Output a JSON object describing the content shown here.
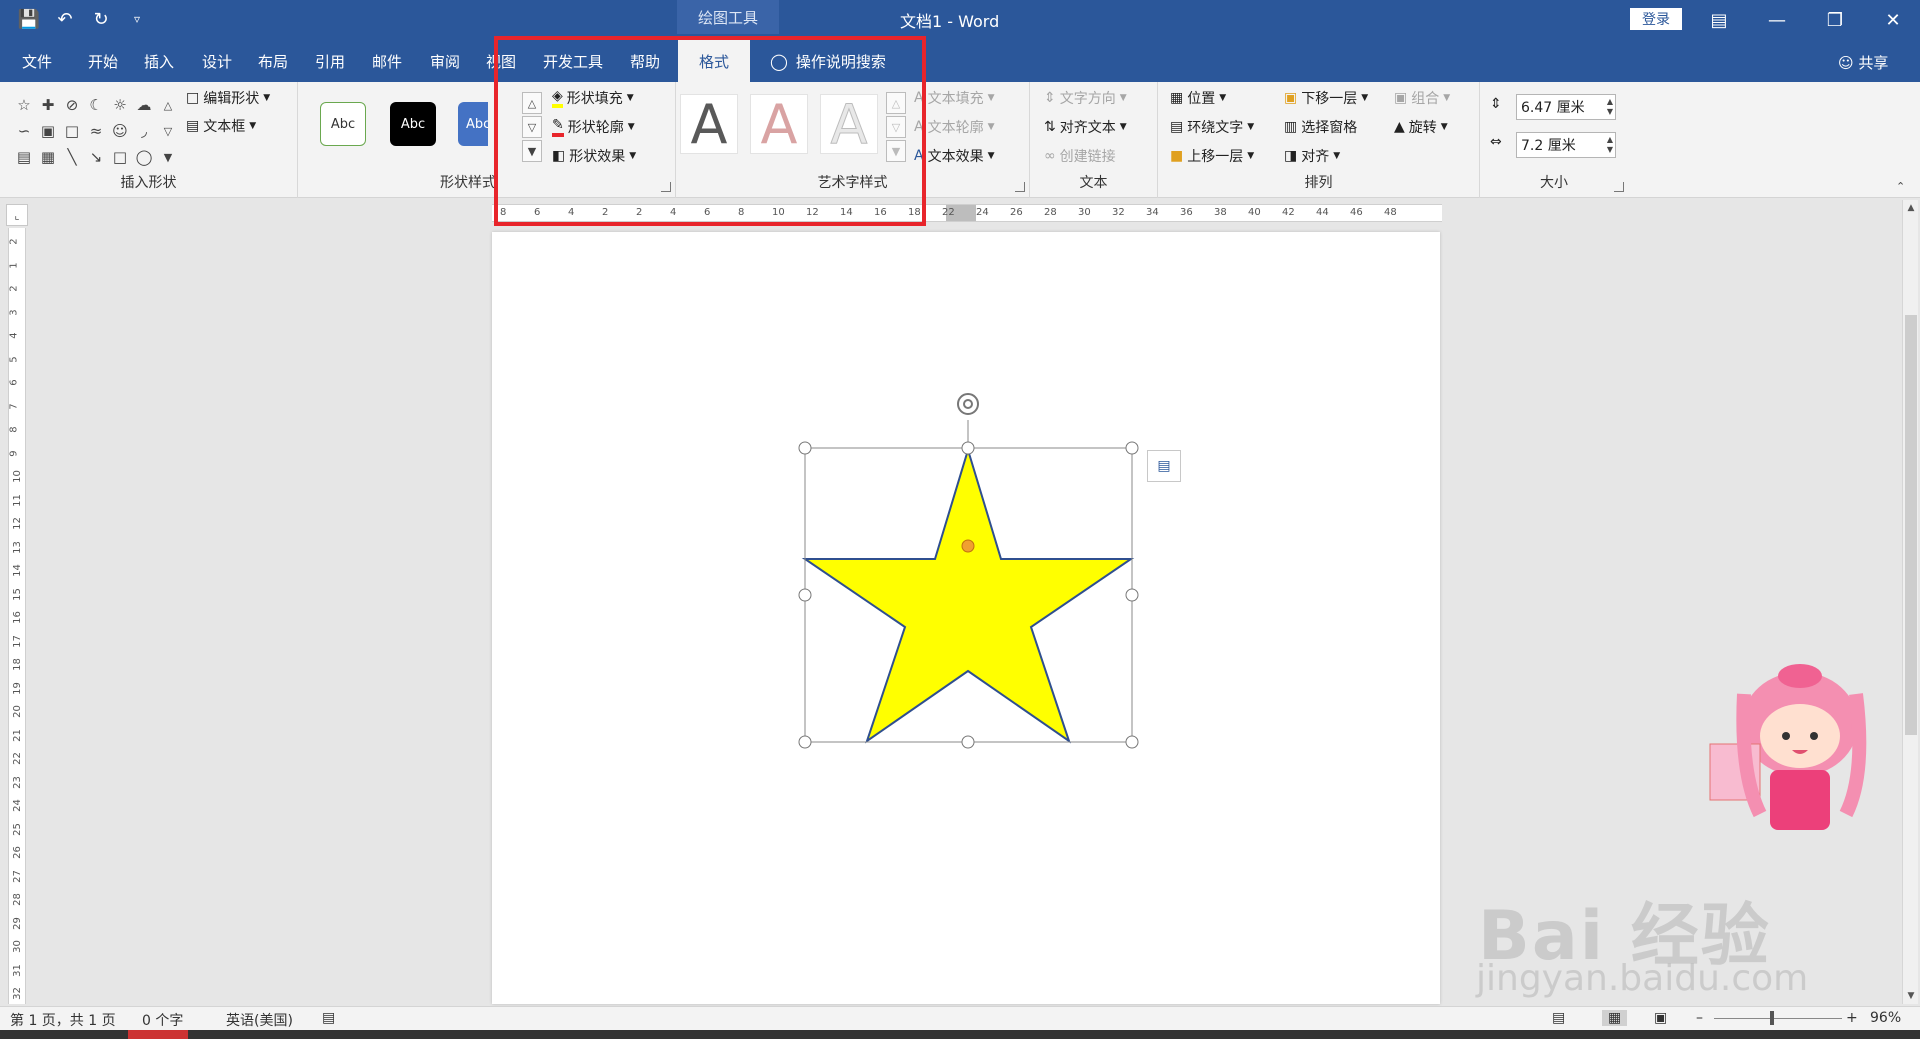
{
  "titlebar": {
    "context_title": "绘图工具",
    "doc_title": "文档1 - Word",
    "login_label": "登录"
  },
  "tabs": [
    {
      "label": "文件"
    },
    {
      "label": "开始"
    },
    {
      "label": "插入"
    },
    {
      "label": "设计"
    },
    {
      "label": "布局"
    },
    {
      "label": "引用"
    },
    {
      "label": "邮件"
    },
    {
      "label": "审阅"
    },
    {
      "label": "视图"
    },
    {
      "label": "开发工具"
    },
    {
      "label": "帮助"
    },
    {
      "label": "格式"
    }
  ],
  "search": {
    "label": "操作说明搜索"
  },
  "share_label": "共享",
  "ribbon": {
    "insert_shapes": {
      "edit_shape": "编辑形状",
      "text_box": "文本框",
      "label": "插入形状"
    },
    "shape_styles": {
      "swatches": [
        "Abc",
        "Abc",
        "Abc"
      ],
      "fill": "形状填充",
      "outline": "形状轮廓",
      "effects": "形状效果",
      "label": "形状样式"
    },
    "wordart_styles": {
      "letters": [
        "A",
        "A",
        "A"
      ],
      "text_fill": "文本填充",
      "text_outline": "文本轮廓",
      "text_effects": "文本效果",
      "label": "艺术字样式"
    },
    "text": {
      "direction": "文字方向",
      "align": "对齐文本",
      "link": "创建链接",
      "label": "文本"
    },
    "arrange": {
      "position": "位置",
      "wrap": "环绕文字",
      "bring_forward": "上移一层",
      "send_backward": "下移一层",
      "selection_pane": "选择窗格",
      "align": "对齐",
      "group": "组合",
      "rotate": "旋转",
      "label": "排列"
    },
    "size": {
      "height": "6.47 厘米",
      "width": "7.2 厘米",
      "label": "大小"
    }
  },
  "ruler": {
    "h_ticks": [
      "8",
      "6",
      "4",
      "2",
      "2",
      "4",
      "6",
      "8",
      "10",
      "12",
      "14",
      "16",
      "18",
      "22",
      "24",
      "26",
      "28",
      "30",
      "32",
      "34",
      "36",
      "38",
      "40",
      "42",
      "44",
      "46",
      "48"
    ],
    "v_ticks": [
      "2",
      "1",
      "2",
      "3",
      "4",
      "5",
      "6",
      "7",
      "8",
      "9",
      "10",
      "11",
      "12",
      "13",
      "14",
      "15",
      "16",
      "17",
      "18",
      "19",
      "20",
      "21",
      "22",
      "23",
      "24",
      "25",
      "26",
      "27",
      "28",
      "29",
      "30",
      "31",
      "32"
    ]
  },
  "status": {
    "page": "第 1 页，共 1 页",
    "words": "0 个字",
    "language": "英语(美国)",
    "zoom": "96%"
  },
  "watermark": {
    "text": "Bai 经验",
    "url": "jingyan.baidu.com"
  },
  "colors": {
    "accent": "#2b579a",
    "star_fill": "#ffff00",
    "star_stroke": "#2f4f8f",
    "highlight": "#e8252b"
  }
}
